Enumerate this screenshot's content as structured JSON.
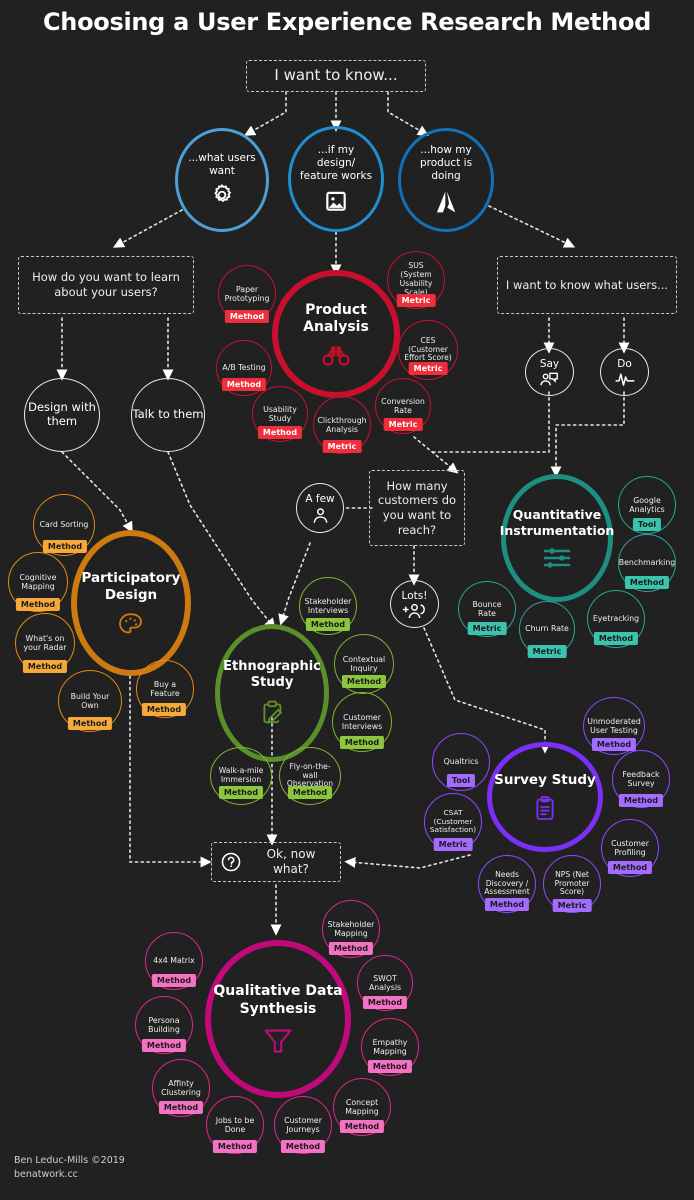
{
  "title": "Choosing a User Experience Research Method",
  "footer": {
    "line1": "Ben Leduc-Mills ©2019",
    "line2": "benatwork.cc"
  },
  "start": {
    "label": "I want to know..."
  },
  "branches": [
    {
      "label": "...what users want",
      "icon": "gear-icon",
      "color": "#4d9fd6"
    },
    {
      "label": "...if my design/ feature works",
      "icon": "image-icon",
      "color": "#1f8fd0"
    },
    {
      "label": "...how my product is doing",
      "icon": "analytics-icon",
      "color": "#1272b8"
    }
  ],
  "decisions": [
    {
      "id": "learn-about-users",
      "label": "How do you want to learn about your users?"
    },
    {
      "id": "know-what-users",
      "label": "I want to know what users..."
    },
    {
      "id": "how-many-customers",
      "label": "How many customers do you want to reach?"
    },
    {
      "id": "ok-now-what",
      "label": "Ok, now what?"
    }
  ],
  "plain_circles": [
    {
      "id": "design-with-them",
      "label": "Design with them"
    },
    {
      "id": "talk-to-them",
      "label": "Talk to them"
    },
    {
      "id": "say",
      "label": "Say",
      "icon": "speech-person-icon"
    },
    {
      "id": "do",
      "label": "Do",
      "icon": "pulse-icon"
    },
    {
      "id": "a-few",
      "label": "A few",
      "icon": "person-icon"
    },
    {
      "id": "lots",
      "label": "Lots!",
      "icon": "add-people-icon"
    }
  ],
  "clusters": [
    {
      "id": "product-analysis",
      "title": "Product Analysis",
      "icon": "binoculars-icon",
      "color": "#c8102e",
      "tag_color": "#ef2e3c",
      "tag_text": "#ffffff",
      "satellites": [
        {
          "label": "Paper Prototyping",
          "tag": "Method"
        },
        {
          "label": "A/B Testing",
          "tag": "Method"
        },
        {
          "label": "Usability Study",
          "tag": "Method"
        },
        {
          "label": "Clickthrough Analysis",
          "tag": "Metric"
        },
        {
          "label": "Conversion Rate",
          "tag": "Metric"
        },
        {
          "label": "CES (Customer Effort Score)",
          "tag": "Metric"
        },
        {
          "label": "SUS (System Usability Scale)",
          "tag": "Metric"
        }
      ]
    },
    {
      "id": "participatory-design",
      "title": "Participatory Design",
      "icon": "palette-icon",
      "color": "#cd7a10",
      "tag_color": "#f5a93b",
      "tag_text": "#1b1b1b",
      "satellites": [
        {
          "label": "Card Sorting",
          "tag": "Method"
        },
        {
          "label": "Cognitive Mapping",
          "tag": "Method"
        },
        {
          "label": "What's on your Radar",
          "tag": "Method"
        },
        {
          "label": "Build Your Own",
          "tag": "Method"
        },
        {
          "label": "Buy a Feature",
          "tag": "Method"
        }
      ]
    },
    {
      "id": "ethnographic-study",
      "title": "Ethnographic Study",
      "icon": "clipboard-pencil-icon",
      "color": "#5b8f29",
      "tag_color": "#8cc63e",
      "tag_text": "#1b1b1b",
      "satellites": [
        {
          "label": "Stakeholder Interviews",
          "tag": "Method"
        },
        {
          "label": "Contextual Inquiry",
          "tag": "Method"
        },
        {
          "label": "Customer Interviews",
          "tag": "Method"
        },
        {
          "label": "Walk-a-mile Immersion",
          "tag": "Method"
        },
        {
          "label": "Fly-on-the-wall Observation",
          "tag": "Method"
        }
      ]
    },
    {
      "id": "quantitative-instrumentation",
      "title": "Quantitative Instrumentation",
      "icon": "sliders-icon",
      "color": "#1d8f80",
      "tag_color": "#3bc3ae",
      "tag_text": "#1b1b1b",
      "satellites": [
        {
          "label": "Google Analytics",
          "tag": "Tool"
        },
        {
          "label": "Benchmarking",
          "tag": "Method"
        },
        {
          "label": "Eyetracking",
          "tag": "Method"
        },
        {
          "label": "Churn Rate",
          "tag": "Metric"
        },
        {
          "label": "Bounce Rate",
          "tag": "Metric"
        }
      ]
    },
    {
      "id": "survey-study",
      "title": "Survey Study",
      "icon": "survey-clipboard-icon",
      "color": "#7b2ff7",
      "tag_color": "#a46bff",
      "tag_text": "#1b1b1b",
      "satellites": [
        {
          "label": "Unmoderated User Testing",
          "tag": "Method"
        },
        {
          "label": "Feedback Survey",
          "tag": "Method"
        },
        {
          "label": "Customer Profiling",
          "tag": "Method"
        },
        {
          "label": "NPS (Net Promoter Score)",
          "tag": "Metric"
        },
        {
          "label": "Needs Discovery / Assessment",
          "tag": "Method"
        },
        {
          "label": "CSAT (Customer Satisfaction)",
          "tag": "Metric"
        },
        {
          "label": "Qualtrics",
          "tag": "Tool"
        }
      ]
    },
    {
      "id": "qualitative-data-synthesis",
      "title": "Qualitative Data Synthesis",
      "icon": "funnel-icon",
      "color": "#c2097c",
      "tag_color": "#f472c4",
      "tag_text": "#1b1b1b",
      "satellites": [
        {
          "label": "Stakeholder Mapping",
          "tag": "Method"
        },
        {
          "label": "SWOT Analysis",
          "tag": "Method"
        },
        {
          "label": "Empathy Mapping",
          "tag": "Method"
        },
        {
          "label": "Concept Mapping",
          "tag": "Method"
        },
        {
          "label": "Customer Journeys",
          "tag": "Method"
        },
        {
          "label": "Jobs to be Done",
          "tag": "Method"
        },
        {
          "label": "Affinty Clustering",
          "tag": "Method"
        },
        {
          "label": "Persona Building",
          "tag": "Method"
        },
        {
          "label": "4x4 Matrix",
          "tag": "Method"
        }
      ]
    }
  ]
}
